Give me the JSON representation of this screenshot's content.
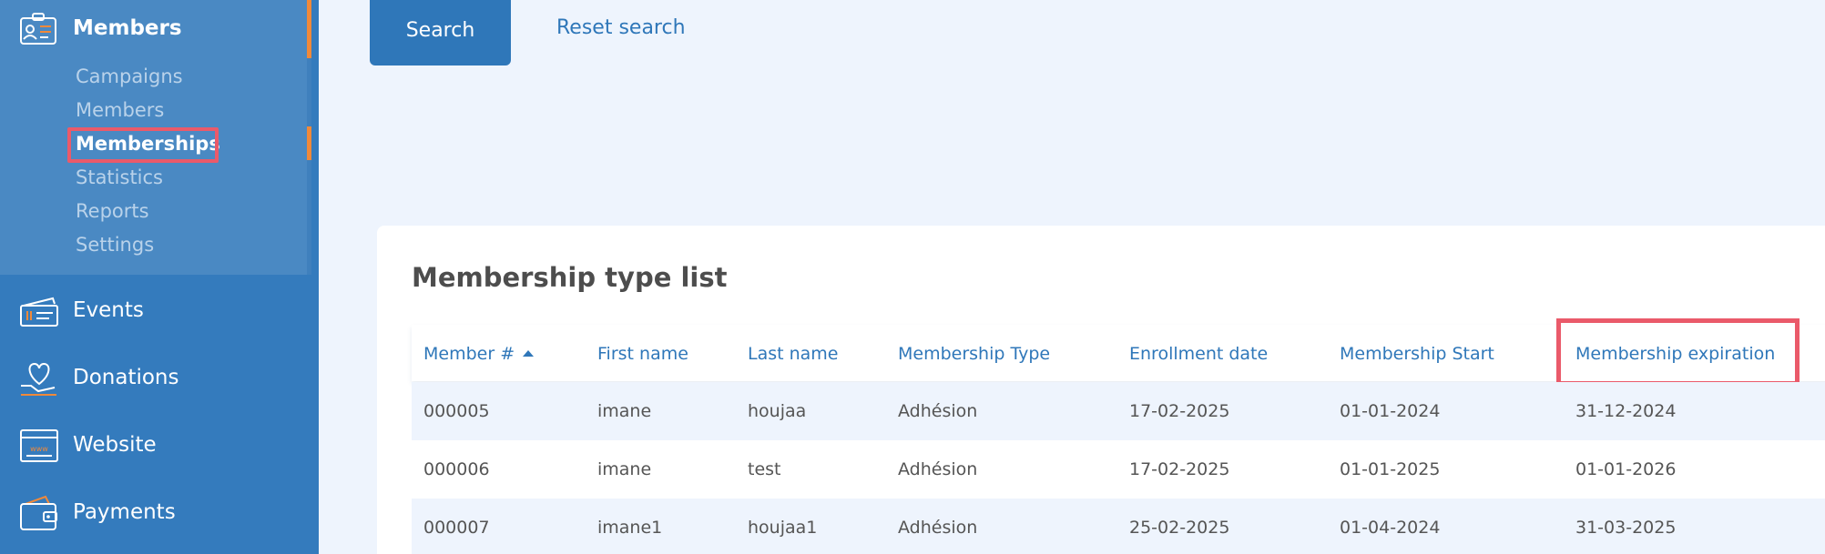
{
  "sidebar": {
    "group_title": "Members",
    "sub_items": [
      "Campaigns",
      "Members",
      "Memberships",
      "Statistics",
      "Reports",
      "Settings"
    ],
    "active_sub_item": "Memberships",
    "main_items": [
      "Events",
      "Donations",
      "Website",
      "Payments"
    ],
    "icons": {
      "members": "id-card-icon",
      "events": "tickets-icon",
      "donations": "heart-hand-icon",
      "website": "browser-window-icon",
      "payments": "wallet-icon"
    }
  },
  "search": {
    "search_label": "Search",
    "reset_label": "Reset search"
  },
  "table": {
    "title": "Membership type list",
    "sort_column": "Member #",
    "sort_direction": "ascending",
    "columns": [
      "Member #",
      "First name",
      "Last name",
      "Membership Type",
      "Enrollment date",
      "Membership Start",
      "Membership expiration"
    ],
    "highlighted_column": "Membership expiration",
    "rows": [
      [
        "000005",
        "imane",
        "houjaa",
        "Adhésion",
        "17-02-2025",
        "01-01-2024",
        "31-12-2024"
      ],
      [
        "000006",
        "imane",
        "test",
        "Adhésion",
        "17-02-2025",
        "01-01-2025",
        "01-01-2026"
      ],
      [
        "000007",
        "imane1",
        "houjaa1",
        "Adhésion",
        "25-02-2025",
        "01-04-2024",
        "31-03-2025"
      ]
    ]
  },
  "colors": {
    "sidebar_bg": "#347bbd",
    "sidebar_section_bg": "#4a89c3",
    "accent_orange": "#f0893a",
    "primary_blue": "#2f77b9",
    "highlight_red": "#ea5a6a",
    "page_bg": "#eef4fd"
  }
}
